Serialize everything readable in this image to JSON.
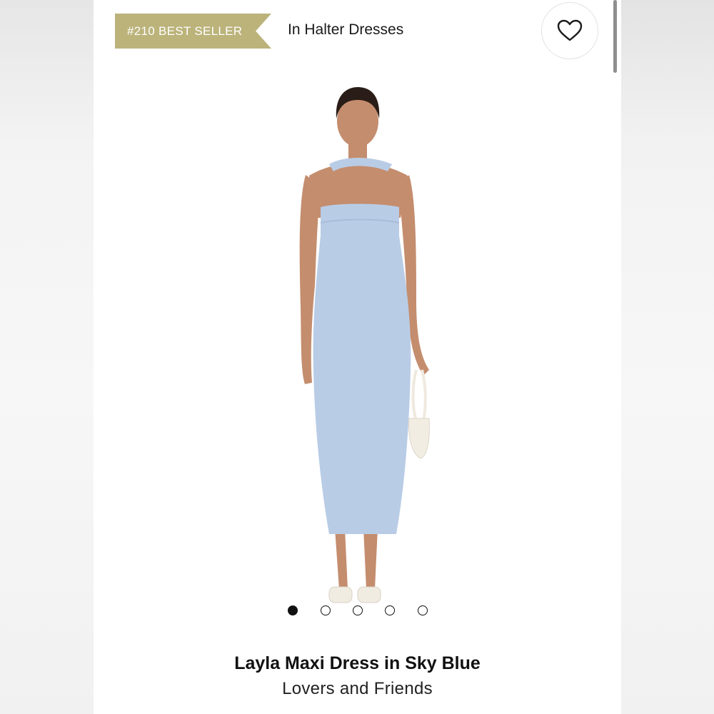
{
  "badge": {
    "label": "#210 BEST SELLER",
    "color": "#bbb37a"
  },
  "category": {
    "label": "In Halter Dresses"
  },
  "wishlist": {
    "icon": "heart-icon"
  },
  "gallery": {
    "total": 5,
    "active_index": 1
  },
  "product": {
    "title": "Layla Maxi Dress in Sky Blue",
    "brand": "Lovers and Friends",
    "dress_color": "#b9cce6"
  }
}
